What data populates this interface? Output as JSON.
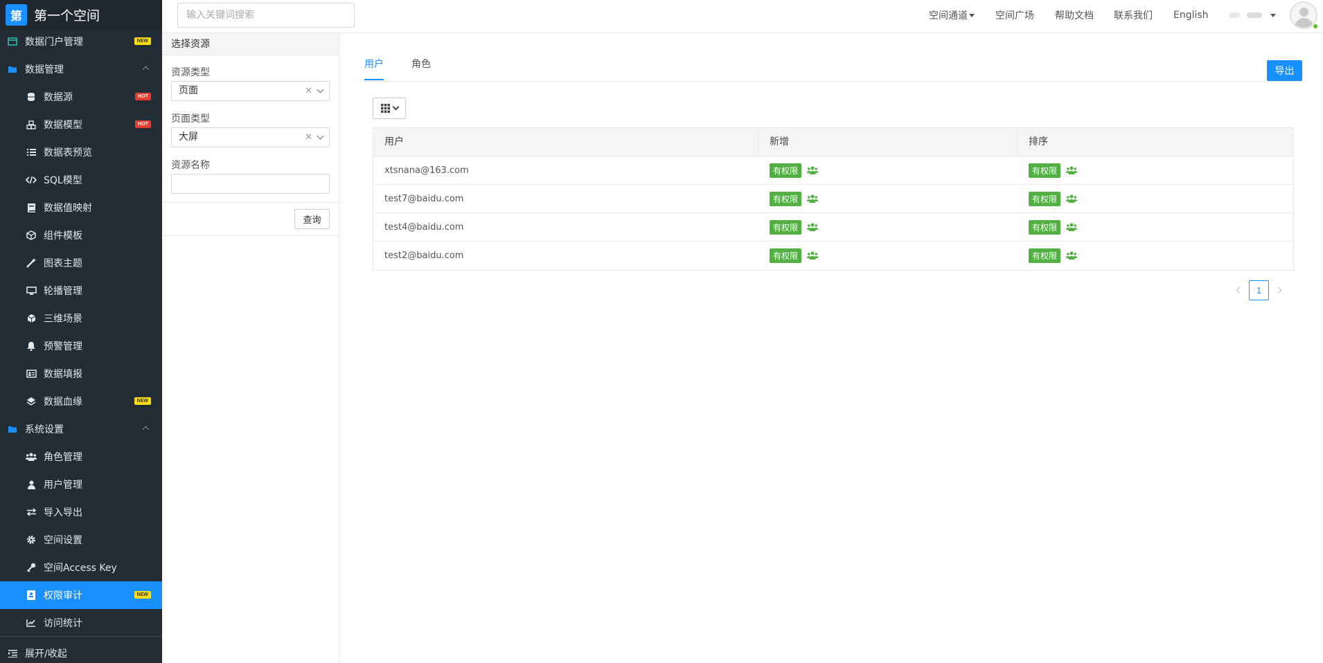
{
  "brand": {
    "logo_char": "第",
    "title": "第一个空间"
  },
  "sidebar": {
    "items": [
      {
        "label": "数据门户管理",
        "badge": "NEW",
        "icon": "portal-icon"
      },
      {
        "label": "数据管理",
        "icon": "folder-icon"
      },
      {
        "label": "数据源",
        "badge": "HOT",
        "icon": "database-icon"
      },
      {
        "label": "数据模型",
        "badge": "HOT",
        "icon": "cubes-icon"
      },
      {
        "label": "数据表预览",
        "icon": "list-icon"
      },
      {
        "label": "SQL模型",
        "icon": "code-icon"
      },
      {
        "label": "数据值映射",
        "icon": "book-icon"
      },
      {
        "label": "组件模板",
        "icon": "component-icon"
      },
      {
        "label": "图表主题",
        "icon": "magic-wand-icon"
      },
      {
        "label": "轮播管理",
        "icon": "monitor-icon"
      },
      {
        "label": "三维场景",
        "icon": "cube-icon"
      },
      {
        "label": "预警管理",
        "icon": "bell-icon"
      },
      {
        "label": "数据填报",
        "icon": "id-card-icon"
      },
      {
        "label": "数据血缘",
        "badge": "NEW",
        "icon": "layers-icon"
      },
      {
        "label": "系统设置",
        "icon": "folder-icon"
      },
      {
        "label": "角色管理",
        "icon": "users-icon"
      },
      {
        "label": "用户管理",
        "icon": "user-icon"
      },
      {
        "label": "导入导出",
        "icon": "exchange-icon"
      },
      {
        "label": "空间设置",
        "icon": "gear-icon"
      },
      {
        "label": "空间Access Key",
        "icon": "key-icon"
      },
      {
        "label": "权限审计",
        "badge": "NEW",
        "icon": "audit-icon"
      },
      {
        "label": "访问统计",
        "icon": "line-chart-icon"
      }
    ],
    "toggle_label": "展开/收起"
  },
  "topbar": {
    "search_placeholder": "输入关键词搜索",
    "nav": [
      "空间通道",
      "空间广场",
      "帮助文档",
      "联系我们",
      "English"
    ]
  },
  "filter": {
    "header": "选择资源",
    "resource_type_label": "资源类型",
    "resource_type_value": "页面",
    "page_type_label": "页面类型",
    "page_type_value": "大屏",
    "resource_name_label": "资源名称",
    "query_label": "查询"
  },
  "main": {
    "tabs": [
      "用户",
      "角色"
    ],
    "export_label": "导出",
    "columns": [
      "用户",
      "新增",
      "排序"
    ],
    "rows": [
      {
        "user": "xtsnana@163.com",
        "add": "有权限",
        "sort": "有权限"
      },
      {
        "user": "test7@baidu.com",
        "add": "有权限",
        "sort": "有权限"
      },
      {
        "user": "test4@baidu.com",
        "add": "有权限",
        "sort": "有权限"
      },
      {
        "user": "test2@baidu.com",
        "add": "有权限",
        "sort": "有权限"
      }
    ],
    "current_page": "1"
  },
  "colors": {
    "accent": "#1890ff",
    "sidebar_bg": "#222d36",
    "permission_green": "#52b043",
    "badge_new": "#fadb14",
    "badge_hot": "#e53e2f"
  }
}
